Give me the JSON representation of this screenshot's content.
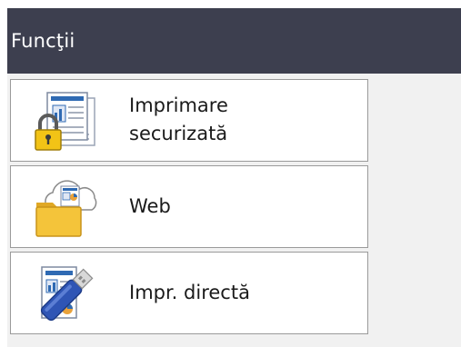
{
  "header": {
    "title": "Funcţii"
  },
  "menu": {
    "items": [
      {
        "line1": "Imprimare",
        "line2": "securizată",
        "icon": "secure-print-icon"
      },
      {
        "label": "Web",
        "icon": "web-cloud-folder-icon"
      },
      {
        "label": "Impr. directă",
        "icon": "usb-direct-print-icon"
      }
    ]
  }
}
